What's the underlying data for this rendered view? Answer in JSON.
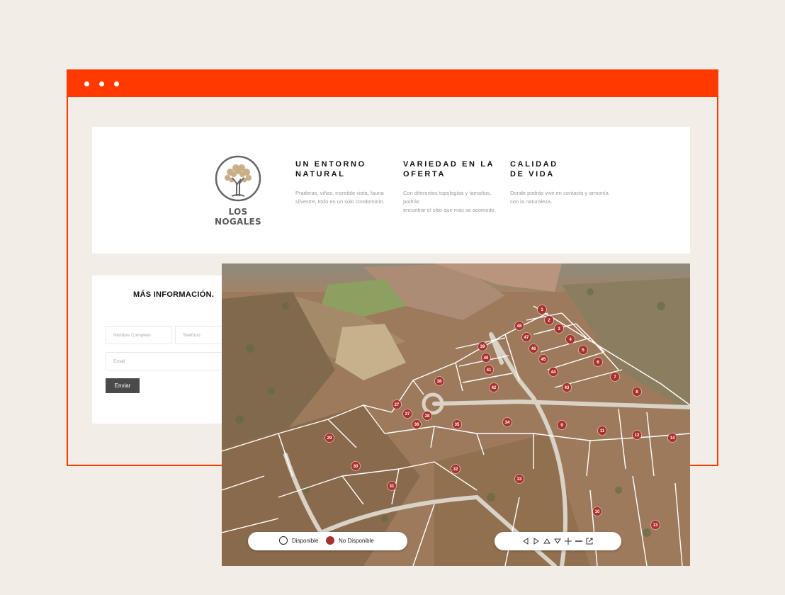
{
  "brand": {
    "name": "LOS NOGALES"
  },
  "features": [
    {
      "title_line1": "UN ENTORNO",
      "title_line2": "NATURAL",
      "desc_line1": "Praderas, viñas, increible vista, fauna",
      "desc_line2": "silvestre, todo en un solo condominio."
    },
    {
      "title_line1": "VARIEDAD EN LA",
      "title_line2": "OFERTA",
      "desc_line1": "Con diferentes topologías y tamaños, podrás",
      "desc_line2": "encontrar el sitio que más se acomode."
    },
    {
      "title_line1": "CALIDAD",
      "title_line2": "DE VIDA",
      "desc_line1": "Donde podrás vivir en contacto y armonía",
      "desc_line2": "con la naturaleza."
    }
  ],
  "form": {
    "title": "MÁS INFORMACIÓN.",
    "name_placeholder": "Nombre Completo",
    "phone_placeholder": "Telefono",
    "email_placeholder": "Email",
    "submit_label": "Enviar"
  },
  "legend": {
    "available_label": "Disponible",
    "unavailable_label": "No Disponible",
    "unavailable_color": "#a8322d"
  },
  "map_controls": [
    "left-arrow-icon",
    "right-arrow-icon",
    "up-arrow-icon",
    "down-arrow-icon",
    "move-icon",
    "zoom-out-icon",
    "external-link-icon"
  ],
  "lots": [
    "1",
    "2",
    "3",
    "4",
    "5",
    "6",
    "7",
    "8",
    "9",
    "10",
    "11",
    "12",
    "13",
    "14",
    "27",
    "28",
    "29",
    "30",
    "31",
    "32",
    "33",
    "34",
    "35",
    "36",
    "37",
    "38",
    "39",
    "40",
    "41",
    "42",
    "43",
    "44",
    "45",
    "46",
    "47",
    "48"
  ],
  "colors": {
    "accent": "#ff3a00",
    "page_bg": "#f2ede7"
  }
}
